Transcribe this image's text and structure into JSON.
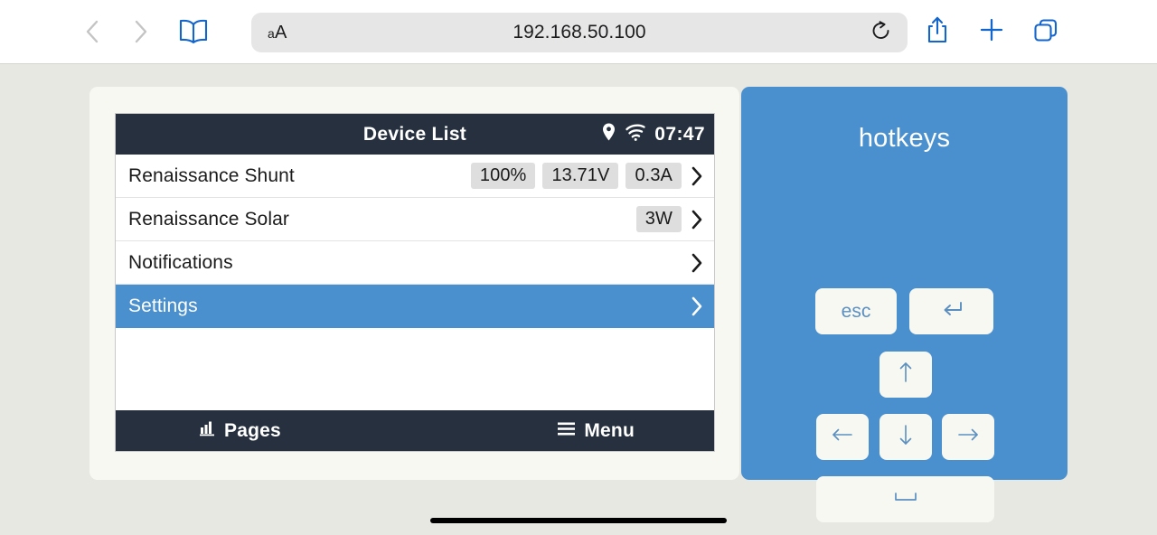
{
  "browser": {
    "url": "192.168.50.100",
    "text_size_small": "a",
    "text_size_large": "A",
    "back_icon": "chevron-left-icon",
    "forward_icon": "chevron-right-icon",
    "bookmarks_icon": "book-icon",
    "reload_icon": "reload-icon",
    "share_icon": "share-icon",
    "new_tab_icon": "plus-icon",
    "tabs_icon": "tabs-icon",
    "accent_color": "#1264cf",
    "disabled_color": "#c4c4c4",
    "bar_background": "#ffffff",
    "address_background": "#e6e6e6"
  },
  "device_panel": {
    "header": {
      "title": "Device List",
      "clock": "07:47",
      "location_icon": "location-pin-icon",
      "wifi_icon": "wifi-icon",
      "background": "#26303f"
    },
    "rows": [
      {
        "label": "Renaissance Shunt",
        "badges": [
          "100%",
          "13.71V",
          "0.3A"
        ],
        "selected": false,
        "chevron_icon": "chevron-right-icon"
      },
      {
        "label": "Renaissance Solar",
        "badges": [
          "3W"
        ],
        "selected": false,
        "chevron_icon": "chevron-right-icon"
      },
      {
        "label": "Notifications",
        "badges": [],
        "selected": false,
        "chevron_icon": "chevron-right-icon"
      },
      {
        "label": "Settings",
        "badges": [],
        "selected": true,
        "chevron_icon": "chevron-right-icon"
      }
    ],
    "footer": {
      "pages_label": "Pages",
      "pages_icon": "bar-chart-icon",
      "menu_label": "Menu",
      "menu_icon": "hamburger-icon"
    },
    "selection_color": "#4a90ce",
    "badge_color": "#dedede"
  },
  "hotkeys": {
    "title": "hotkeys",
    "panel_color": "#4a90ce",
    "key_color": "#f8f8f3",
    "glyph_color": "#5a8fc0",
    "keys": [
      {
        "name": "esc",
        "label": "esc",
        "glyph": "text"
      },
      {
        "name": "enter",
        "label": "↵",
        "glyph": "return-arrow-icon"
      },
      {
        "name": "up",
        "label": "↑",
        "glyph": "arrow-up-icon"
      },
      {
        "name": "left",
        "label": "←",
        "glyph": "arrow-left-icon"
      },
      {
        "name": "down",
        "label": "↓",
        "glyph": "arrow-down-icon"
      },
      {
        "name": "right",
        "label": "→",
        "glyph": "arrow-right-icon"
      },
      {
        "name": "space",
        "label": "␣",
        "glyph": "space-bar-icon"
      }
    ]
  },
  "page": {
    "background": "#e7e8e2",
    "card_background": "#f8f8f3"
  }
}
